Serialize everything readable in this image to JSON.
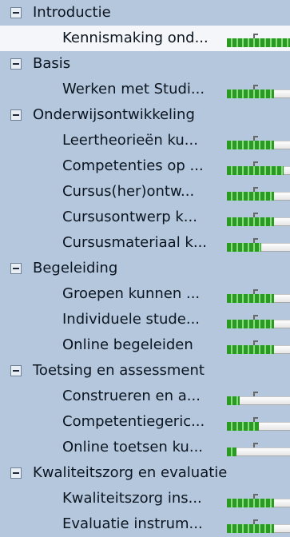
{
  "groups": [
    {
      "label": "Introductie",
      "items": [
        {
          "label": "Kennismaking ond...",
          "progress": 1.0,
          "selected": true
        }
      ]
    },
    {
      "label": "Basis",
      "items": [
        {
          "label": "Werken met Studi...",
          "progress": 0.75
        }
      ]
    },
    {
      "label": "Onderwijsontwikkeling",
      "items": [
        {
          "label": "Leertheorieën ku...",
          "progress": 0.75
        },
        {
          "label": "Competenties op ...",
          "progress": 0.9
        },
        {
          "label": "Cursus(her)ontw...",
          "progress": 0.75
        },
        {
          "label": "Cursusontwerp k...",
          "progress": 0.75
        },
        {
          "label": "Cursusmateriaal k...",
          "progress": 0.55
        }
      ]
    },
    {
      "label": "Begeleiding",
      "items": [
        {
          "label": "Groepen kunnen ...",
          "progress": 0.75
        },
        {
          "label": "Individuele stude...",
          "progress": 0.75
        },
        {
          "label": "Online begeleiden",
          "progress": 0.75
        }
      ]
    },
    {
      "label": "Toetsing en assessment",
      "items": [
        {
          "label": "Construeren en a...",
          "progress": 0.2
        },
        {
          "label": "Competentiegeric...",
          "progress": 0.5
        },
        {
          "label": "Online toetsen ku...",
          "progress": 0.15
        }
      ]
    },
    {
      "label": "Kwaliteitszorg en evaluatie",
      "items": [
        {
          "label": "Kwaliteitszorg ins...",
          "progress": 0.75
        },
        {
          "label": "Evaluatie instrum...",
          "progress": 0.75
        }
      ]
    }
  ]
}
